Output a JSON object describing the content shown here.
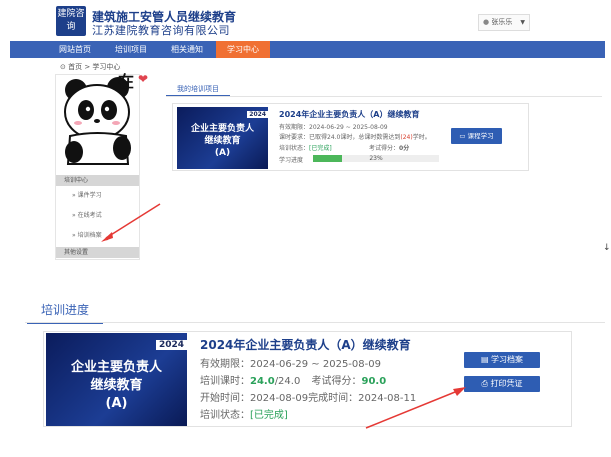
{
  "header": {
    "logo_text": "建院咨询",
    "title": "建筑施工安管人员继续教育",
    "subtitle": "江苏建院教育咨询有限公司",
    "user_name": "张乐乐"
  },
  "nav": {
    "items": [
      "网站首页",
      "培训项目",
      "相关通知",
      "学习中心"
    ],
    "active": "学习中心"
  },
  "breadcrumb": "首页 > 学习中心",
  "sidebar": {
    "sticker_text": "在",
    "section_title": "培训中心",
    "items": [
      "课件学习",
      "在线考试",
      "培训档案"
    ],
    "section2_title": "其他设置"
  },
  "top_panel": {
    "tab": "我的培训项目",
    "card": {
      "thumb_year": "2024",
      "thumb_line1": "企业主要负责人",
      "thumb_line2": "继续教育",
      "thumb_line3": "(A)",
      "title": "2024年企业主要负责人（A）继续教育",
      "validity": "有效期限：2024-06-29 ~ 2025-08-09",
      "hours_req_prefix": "课时要求：已取得24.0课时，总课时数需达到",
      "hours_req_num": "(24)",
      "hours_req_suffix": "学时。",
      "status_label": "培训状态：",
      "status_value": "[已完成]",
      "exam_label": "考试得分：",
      "exam_value": "0分",
      "progress_label": "学习进度",
      "progress_value": 0.23,
      "progress_text": "23%",
      "button": "课程学习"
    }
  },
  "bottom_panel": {
    "tab": "培训进度",
    "card": {
      "thumb_year": "2024",
      "thumb_line1": "企业主要负责人",
      "thumb_line2": "继续教育",
      "thumb_line3": "(A)",
      "title": "2024年企业主要负责人（A）继续教育",
      "validity": "有效期限：2024-06-29 ~ 2025-08-09",
      "hours_label": "培训课时：",
      "hours_done": "24.0",
      "hours_total": "/24.0",
      "exam_label": "考试得分：",
      "exam_value": "90.0",
      "time_line": "开始时间：2024-08-09完成时间：2024-08-11",
      "status_label": "培训状态：",
      "status_value": "[已完成]",
      "btn_archive": "学习档案",
      "btn_print": "打印凭证"
    }
  },
  "colors": {
    "brand": "#1d3f8a",
    "nav_bg": "#3a63b6",
    "nav_active": "#f07033",
    "button": "#2e5db3",
    "success": "#2aa15a",
    "alert": "#d8412f",
    "annotation_arrow": "#e53935"
  }
}
